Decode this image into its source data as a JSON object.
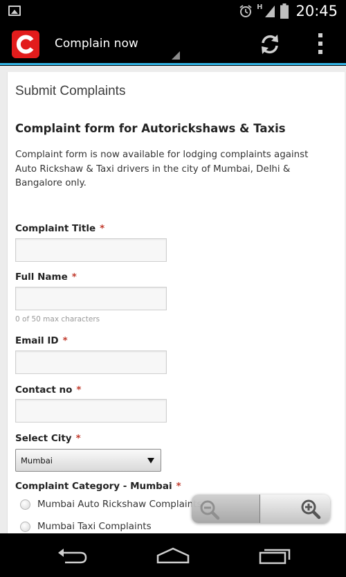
{
  "status_bar": {
    "time": "20:45",
    "network_type": "H",
    "icons": [
      "image-icon",
      "alarm-icon",
      "signal-icon",
      "battery-icon"
    ]
  },
  "action_bar": {
    "app_logo_letter": "C",
    "title": "Complain now",
    "icons": [
      "refresh-icon",
      "overflow-menu-icon"
    ],
    "colors": {
      "logo": "#e21c1c",
      "accent_line": "#33b5e5"
    }
  },
  "page": {
    "heading": "Submit Complaints",
    "form_title": "Complaint form for Autorickshaws & Taxis",
    "description": "Complaint form is now available for lodging complaints against Auto Rickshaw & Taxi drivers in the city of Mumbai, Delhi & Bangalore only.",
    "required_mark": "*"
  },
  "form": {
    "complaint_title": {
      "label": "Complaint Title",
      "value": ""
    },
    "full_name": {
      "label": "Full Name",
      "value": "",
      "hint": "0 of 50 max characters"
    },
    "email_id": {
      "label": "Email ID",
      "value": ""
    },
    "contact_no": {
      "label": "Contact no",
      "value": ""
    },
    "select_city": {
      "label": "Select City",
      "selected": "Mumbai"
    },
    "category": {
      "label": "Complaint Category - Mumbai",
      "options": [
        "Mumbai Auto Rickshaw Complaints",
        "Mumbai Taxi Complaints"
      ]
    }
  },
  "zoom": {
    "icons": [
      "zoom-out-icon",
      "zoom-in-icon"
    ]
  },
  "nav_bar": {
    "icons": [
      "back-icon",
      "home-icon",
      "recent-apps-icon"
    ]
  }
}
